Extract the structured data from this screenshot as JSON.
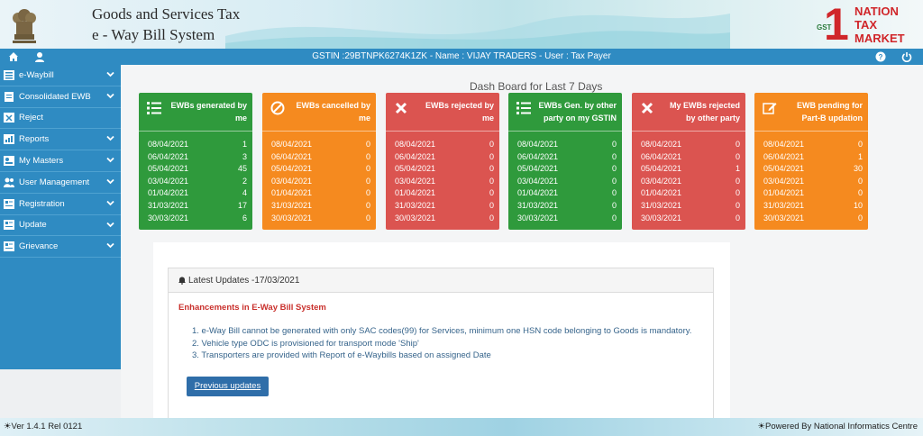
{
  "header": {
    "title_line1": "Goods and Services Tax",
    "title_line2": "e - Way Bill System",
    "logo": {
      "mark": "1",
      "gst": "GST",
      "line1": "NATION",
      "line2": "TAX",
      "line3": "MARKET"
    }
  },
  "topbar": {
    "info": "GSTIN :29BTNPK6274K1ZK - Name : VIJAY TRADERS - User : Tax Payer",
    "icons": [
      "home-icon",
      "user-icon",
      "help-icon",
      "power-icon"
    ]
  },
  "sidebar": {
    "items": [
      {
        "label": "e-Waybill",
        "icon": "sitemap-icon",
        "has_chevron": true
      },
      {
        "label": "Consolidated EWB",
        "icon": "doc-icon",
        "has_chevron": true
      },
      {
        "label": "Reject",
        "icon": "reject-icon",
        "has_chevron": false
      },
      {
        "label": "Reports",
        "icon": "report-icon",
        "has_chevron": true
      },
      {
        "label": "My Masters",
        "icon": "masters-icon",
        "has_chevron": true
      },
      {
        "label": "User Management",
        "icon": "users-icon",
        "has_chevron": true
      },
      {
        "label": "Registration",
        "icon": "registration-icon",
        "has_chevron": true
      },
      {
        "label": "Update",
        "icon": "update-icon",
        "has_chevron": true
      },
      {
        "label": "Grievance",
        "icon": "grievance-icon",
        "has_chevron": true
      }
    ]
  },
  "dashboard": {
    "title": "Dash Board for Last 7 Days",
    "cards": [
      {
        "title": "EWBs generated by me",
        "color": "#2f9a3c",
        "icon": "list-icon",
        "rows": [
          [
            "08/04/2021",
            "1"
          ],
          [
            "06/04/2021",
            "3"
          ],
          [
            "05/04/2021",
            "45"
          ],
          [
            "03/04/2021",
            "2"
          ],
          [
            "01/04/2021",
            "4"
          ],
          [
            "31/03/2021",
            "17"
          ],
          [
            "30/03/2021",
            "6"
          ]
        ]
      },
      {
        "title": "EWBs cancelled by me",
        "color": "#f58a1f",
        "icon": "ban-icon",
        "rows": [
          [
            "08/04/2021",
            "0"
          ],
          [
            "06/04/2021",
            "0"
          ],
          [
            "05/04/2021",
            "0"
          ],
          [
            "03/04/2021",
            "0"
          ],
          [
            "01/04/2021",
            "0"
          ],
          [
            "31/03/2021",
            "0"
          ],
          [
            "30/03/2021",
            "0"
          ]
        ]
      },
      {
        "title": "EWBs rejected by me",
        "color": "#db5450",
        "icon": "times-icon",
        "rows": [
          [
            "08/04/2021",
            "0"
          ],
          [
            "06/04/2021",
            "0"
          ],
          [
            "05/04/2021",
            "0"
          ],
          [
            "03/04/2021",
            "0"
          ],
          [
            "01/04/2021",
            "0"
          ],
          [
            "31/03/2021",
            "0"
          ],
          [
            "30/03/2021",
            "0"
          ]
        ]
      },
      {
        "title": "EWBs Gen. by other party on my GSTIN",
        "color": "#2f9a3c",
        "icon": "list-icon",
        "rows": [
          [
            "08/04/2021",
            "0"
          ],
          [
            "06/04/2021",
            "0"
          ],
          [
            "05/04/2021",
            "0"
          ],
          [
            "03/04/2021",
            "0"
          ],
          [
            "01/04/2021",
            "0"
          ],
          [
            "31/03/2021",
            "0"
          ],
          [
            "30/03/2021",
            "0"
          ]
        ]
      },
      {
        "title": "My EWBs rejected by other party",
        "color": "#db5450",
        "icon": "times-icon",
        "rows": [
          [
            "08/04/2021",
            "0"
          ],
          [
            "06/04/2021",
            "0"
          ],
          [
            "05/04/2021",
            "1"
          ],
          [
            "03/04/2021",
            "0"
          ],
          [
            "01/04/2021",
            "0"
          ],
          [
            "31/03/2021",
            "0"
          ],
          [
            "30/03/2021",
            "0"
          ]
        ]
      },
      {
        "title": "EWB pending for Part-B updation",
        "color": "#f58a1f",
        "icon": "edit-icon",
        "rows": [
          [
            "08/04/2021",
            "0"
          ],
          [
            "06/04/2021",
            "1"
          ],
          [
            "05/04/2021",
            "30"
          ],
          [
            "03/04/2021",
            "0"
          ],
          [
            "01/04/2021",
            "0"
          ],
          [
            "31/03/2021",
            "10"
          ],
          [
            "30/03/2021",
            "0"
          ]
        ]
      }
    ]
  },
  "updates": {
    "header": "Latest Updates -17/03/2021",
    "section_title": "Enhancements in E-Way Bill System",
    "items": [
      "1. e-Way Bill cannot be generated with only SAC codes(99) for Services, minimum one HSN code belonging to Goods is mandatory.",
      "2. Vehicle type ODC is provisioned for transport mode 'Ship'",
      "3. Transporters are provided with Report of e-Waybills based on assigned Date"
    ],
    "button": "Previous updates"
  },
  "footer": {
    "version": "Ver 1.4.1 Rel 0121",
    "powered": "Powered By National Informatics Centre"
  }
}
